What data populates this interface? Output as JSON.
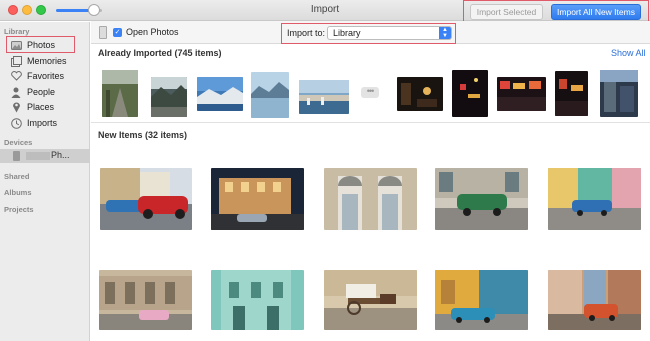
{
  "window": {
    "title": "Import"
  },
  "header_buttons": {
    "import_selected": "Import Selected",
    "import_all": "Import All New Items"
  },
  "sidebar": {
    "library_header": "Library",
    "items": [
      {
        "label": "Photos",
        "icon": "photos-icon"
      },
      {
        "label": "Memories",
        "icon": "memories-icon"
      },
      {
        "label": "Favorites",
        "icon": "heart-icon"
      },
      {
        "label": "People",
        "icon": "person-icon"
      },
      {
        "label": "Places",
        "icon": "pin-icon"
      },
      {
        "label": "Imports",
        "icon": "clock-icon"
      }
    ],
    "devices_header": "Devices",
    "device_label": "Ph...",
    "shared_header": "Shared",
    "albums_header": "Albums",
    "projects_header": "Projects"
  },
  "toolbar": {
    "open_photos_label": "Open Photos",
    "open_photos_checked": true,
    "import_to_label": "Import to:",
    "import_to_value": "Library"
  },
  "already_imported": {
    "title": "Already Imported (745 items)",
    "show_all": "Show All",
    "more_label": "•••"
  },
  "new_items": {
    "title": "New Items (32 items)"
  },
  "colors": {
    "accent": "#2f7cf0",
    "highlight_box": "#e05a6a",
    "sidebar_bg": "#ececec"
  }
}
